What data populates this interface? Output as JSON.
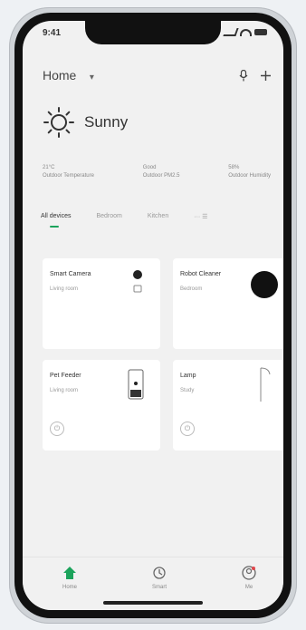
{
  "status_bar": {
    "time": "9:41"
  },
  "header": {
    "title": "Home",
    "dropdown_icon": "chevron-down-icon",
    "icons": [
      "mic-icon",
      "add-icon"
    ]
  },
  "weather": {
    "condition": "Sunny",
    "icon": "sun-icon"
  },
  "stats": [
    {
      "value": "21°C",
      "label": "Outdoor Temperature"
    },
    {
      "value": "Good",
      "label": "Outdoor PM2.5"
    },
    {
      "value": "58%",
      "label": "Outdoor Humidity"
    }
  ],
  "tabs": [
    {
      "label": "All devices",
      "active": true
    },
    {
      "label": "Bedroom",
      "active": false
    },
    {
      "label": "Kitchen",
      "active": false
    },
    {
      "label": "··· ☰",
      "active": false
    }
  ],
  "devices": [
    {
      "name": "Smart Camera",
      "room": "Living room",
      "icon": "camera-icon"
    },
    {
      "name": "Robot Cleaner",
      "room": "Bedroom",
      "icon": "robot-cleaner-icon"
    },
    {
      "name": "Pet Feeder",
      "room": "Living room",
      "icon": "pet-feeder-icon"
    },
    {
      "name": "Lamp",
      "room": "Study",
      "icon": "lamp-icon"
    }
  ],
  "nav": [
    {
      "label": "Home",
      "icon": "home-icon",
      "active": true,
      "color": "#1ba35b"
    },
    {
      "label": "Smart",
      "icon": "smart-icon",
      "active": false
    },
    {
      "label": "Me",
      "icon": "profile-icon",
      "active": false
    }
  ]
}
